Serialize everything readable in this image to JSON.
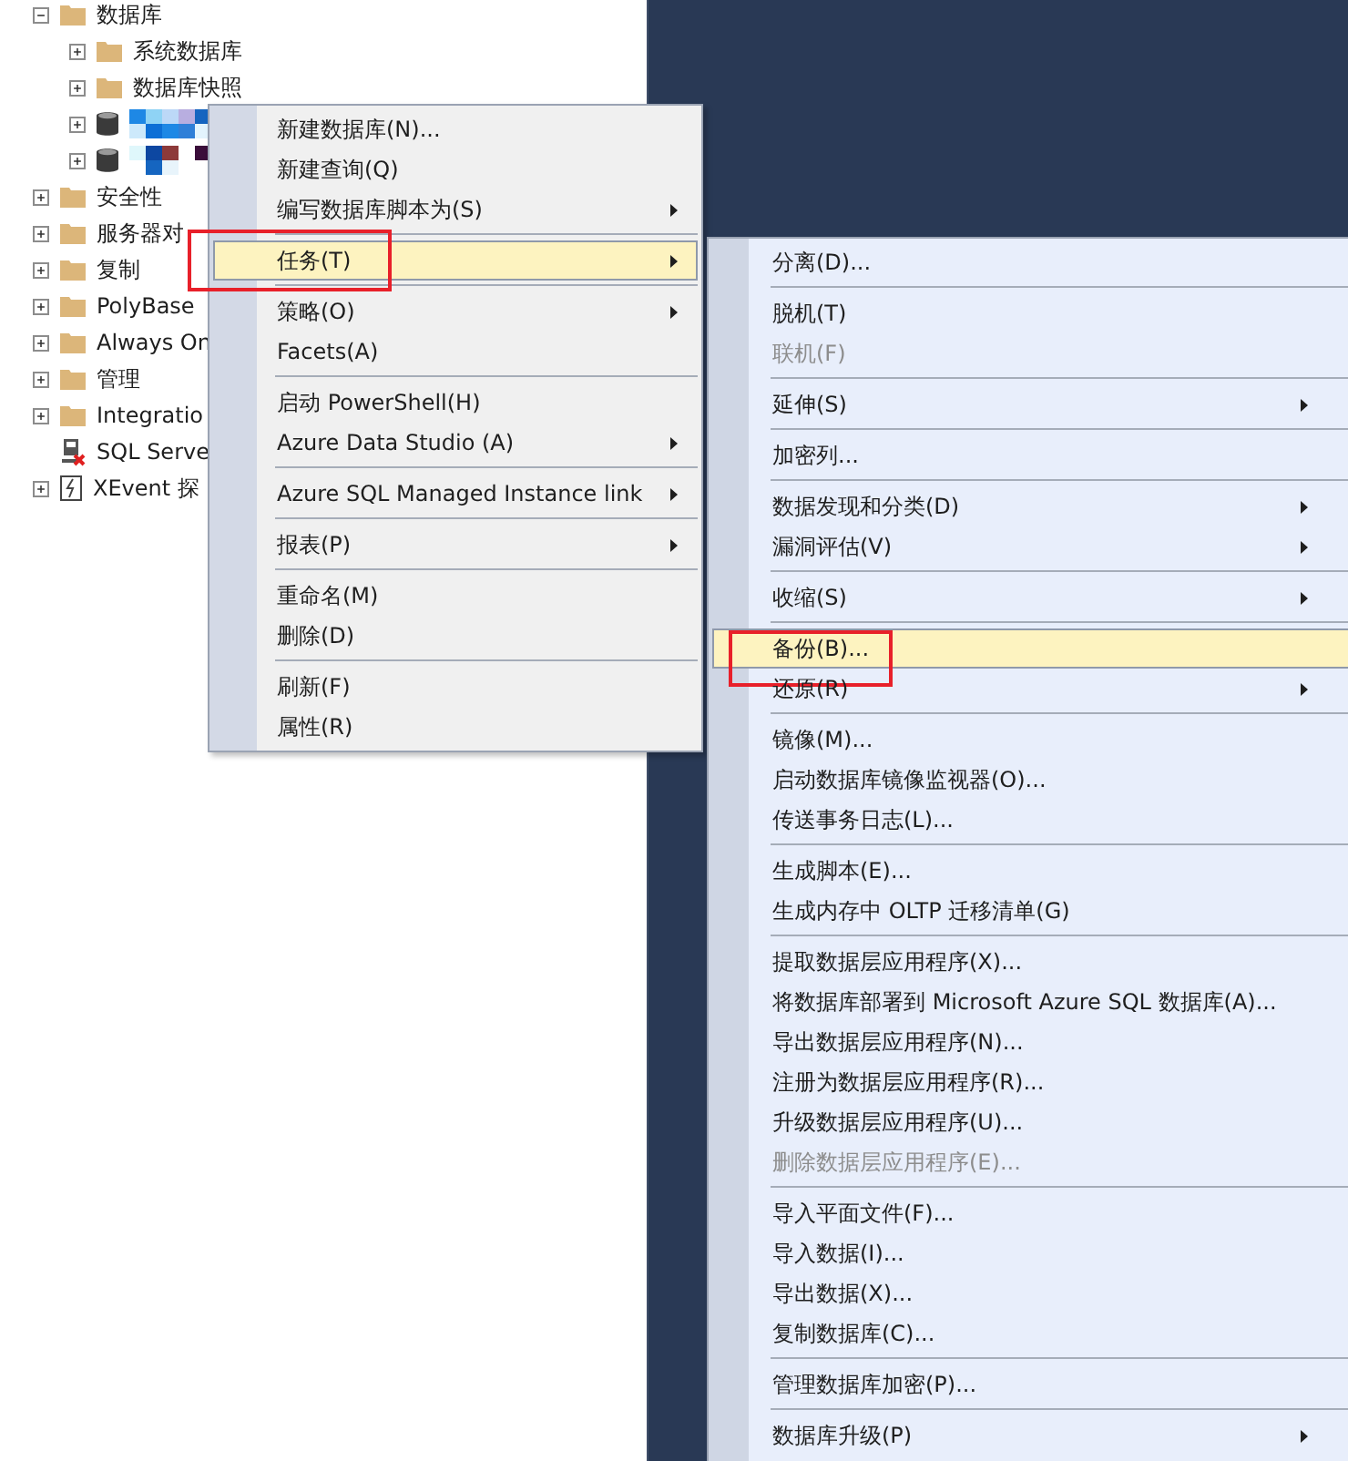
{
  "tree": [
    {
      "label": "数据库",
      "kind": "folder",
      "expanded": true,
      "children": [
        {
          "label": "系统数据库",
          "kind": "folder",
          "expanded": false
        },
        {
          "label": "数据库快照",
          "kind": "folder",
          "expanded": false
        },
        {
          "kind": "database",
          "expanded": false
        },
        {
          "kind": "database",
          "expanded": false
        }
      ]
    },
    {
      "label": "安全性",
      "kind": "folder",
      "expanded": false
    },
    {
      "label": "服务器对",
      "kind": "folder",
      "expanded": false
    },
    {
      "label": "复制",
      "kind": "folder",
      "expanded": false
    },
    {
      "label": "PolyBase",
      "kind": "folder",
      "expanded": false
    },
    {
      "label": "Always On",
      "kind": "folder",
      "expanded": false
    },
    {
      "label": "管理",
      "kind": "folder",
      "expanded": false
    },
    {
      "label": "Integratio",
      "kind": "folder",
      "expanded": false
    },
    {
      "label": "SQL Serve",
      "kind": "agent"
    },
    {
      "label": "XEvent 探",
      "kind": "xevent",
      "expanded": false
    }
  ],
  "context_menu": [
    {
      "kind": "item",
      "label": "新建数据库(N)...",
      "submenu": false,
      "selected": false,
      "disabled": false
    },
    {
      "kind": "item",
      "label": "新建查询(Q)",
      "submenu": false,
      "selected": false,
      "disabled": false
    },
    {
      "kind": "item",
      "label": "编写数据库脚本为(S)",
      "submenu": true,
      "selected": false,
      "disabled": false
    },
    {
      "kind": "separator"
    },
    {
      "kind": "item",
      "label": "任务(T)",
      "submenu": true,
      "selected": true,
      "disabled": false,
      "annotated": true
    },
    {
      "kind": "separator"
    },
    {
      "kind": "item",
      "label": "策略(O)",
      "submenu": true,
      "selected": false,
      "disabled": false
    },
    {
      "kind": "item",
      "label": "Facets(A)",
      "submenu": false,
      "selected": false,
      "disabled": false
    },
    {
      "kind": "separator"
    },
    {
      "kind": "item",
      "label": "启动 PowerShell(H)",
      "submenu": false,
      "selected": false,
      "disabled": false
    },
    {
      "kind": "item",
      "label": "Azure Data Studio (A)",
      "submenu": true,
      "selected": false,
      "disabled": false
    },
    {
      "kind": "separator"
    },
    {
      "kind": "item",
      "label": "Azure SQL Managed Instance link",
      "submenu": true,
      "selected": false,
      "disabled": false
    },
    {
      "kind": "separator"
    },
    {
      "kind": "item",
      "label": "报表(P)",
      "submenu": true,
      "selected": false,
      "disabled": false
    },
    {
      "kind": "separator"
    },
    {
      "kind": "item",
      "label": "重命名(M)",
      "submenu": false,
      "selected": false,
      "disabled": false
    },
    {
      "kind": "item",
      "label": "删除(D)",
      "submenu": false,
      "selected": false,
      "disabled": false
    },
    {
      "kind": "separator"
    },
    {
      "kind": "item",
      "label": "刷新(F)",
      "submenu": false,
      "selected": false,
      "disabled": false
    },
    {
      "kind": "item",
      "label": "属性(R)",
      "submenu": false,
      "selected": false,
      "disabled": false
    }
  ],
  "tasks_submenu": [
    {
      "kind": "item",
      "label": "分离(D)...",
      "submenu": false,
      "selected": false,
      "disabled": false
    },
    {
      "kind": "separator"
    },
    {
      "kind": "item",
      "label": "脱机(T)",
      "submenu": false,
      "selected": false,
      "disabled": false
    },
    {
      "kind": "item",
      "label": "联机(F)",
      "submenu": false,
      "selected": false,
      "disabled": true
    },
    {
      "kind": "separator"
    },
    {
      "kind": "item",
      "label": "延伸(S)",
      "submenu": true,
      "selected": false,
      "disabled": false
    },
    {
      "kind": "separator"
    },
    {
      "kind": "item",
      "label": "加密列...",
      "submenu": false,
      "selected": false,
      "disabled": false
    },
    {
      "kind": "separator"
    },
    {
      "kind": "item",
      "label": "数据发现和分类(D)",
      "submenu": true,
      "selected": false,
      "disabled": false
    },
    {
      "kind": "item",
      "label": "漏洞评估(V)",
      "submenu": true,
      "selected": false,
      "disabled": false
    },
    {
      "kind": "separator"
    },
    {
      "kind": "item",
      "label": "收缩(S)",
      "submenu": true,
      "selected": false,
      "disabled": false
    },
    {
      "kind": "separator"
    },
    {
      "kind": "item",
      "label": "备份(B)...",
      "submenu": false,
      "selected": true,
      "disabled": false,
      "annotated": true
    },
    {
      "kind": "item",
      "label": "还原(R)",
      "submenu": true,
      "selected": false,
      "disabled": false
    },
    {
      "kind": "separator"
    },
    {
      "kind": "item",
      "label": "镜像(M)...",
      "submenu": false,
      "selected": false,
      "disabled": false
    },
    {
      "kind": "item",
      "label": "启动数据库镜像监视器(O)...",
      "submenu": false,
      "selected": false,
      "disabled": false
    },
    {
      "kind": "item",
      "label": "传送事务日志(L)...",
      "submenu": false,
      "selected": false,
      "disabled": false
    },
    {
      "kind": "separator"
    },
    {
      "kind": "item",
      "label": "生成脚本(E)...",
      "submenu": false,
      "selected": false,
      "disabled": false
    },
    {
      "kind": "item",
      "label": "生成内存中 OLTP 迁移清单(G)",
      "submenu": false,
      "selected": false,
      "disabled": false
    },
    {
      "kind": "separator"
    },
    {
      "kind": "item",
      "label": "提取数据层应用程序(X)...",
      "submenu": false,
      "selected": false,
      "disabled": false
    },
    {
      "kind": "item",
      "label": "将数据库部署到 Microsoft Azure SQL 数据库(A)...",
      "submenu": false,
      "selected": false,
      "disabled": false
    },
    {
      "kind": "item",
      "label": "导出数据层应用程序(N)...",
      "submenu": false,
      "selected": false,
      "disabled": false
    },
    {
      "kind": "item",
      "label": "注册为数据层应用程序(R)...",
      "submenu": false,
      "selected": false,
      "disabled": false
    },
    {
      "kind": "item",
      "label": "升级数据层应用程序(U)...",
      "submenu": false,
      "selected": false,
      "disabled": false
    },
    {
      "kind": "item",
      "label": "删除数据层应用程序(E)...",
      "submenu": false,
      "selected": false,
      "disabled": true
    },
    {
      "kind": "separator"
    },
    {
      "kind": "item",
      "label": "导入平面文件(F)...",
      "submenu": false,
      "selected": false,
      "disabled": false
    },
    {
      "kind": "item",
      "label": "导入数据(I)...",
      "submenu": false,
      "selected": false,
      "disabled": false
    },
    {
      "kind": "item",
      "label": "导出数据(X)...",
      "submenu": false,
      "selected": false,
      "disabled": false
    },
    {
      "kind": "item",
      "label": "复制数据库(C)...",
      "submenu": false,
      "selected": false,
      "disabled": false
    },
    {
      "kind": "separator"
    },
    {
      "kind": "item",
      "label": "管理数据库加密(P)...",
      "submenu": false,
      "selected": false,
      "disabled": false
    },
    {
      "kind": "separator"
    },
    {
      "kind": "item",
      "label": "数据库升级(P)",
      "submenu": true,
      "selected": false,
      "disabled": false
    }
  ]
}
